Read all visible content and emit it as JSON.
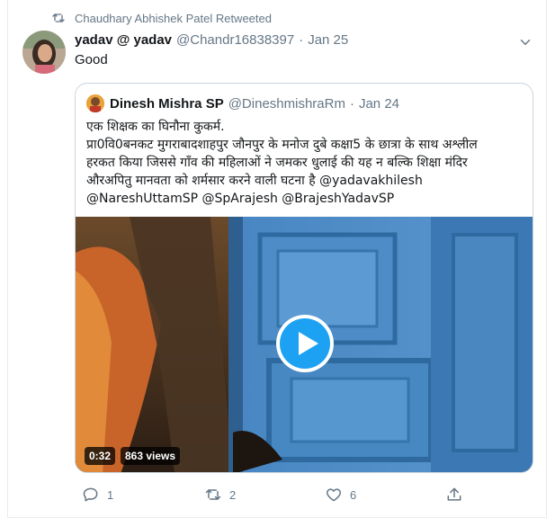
{
  "retweet": {
    "label": "Chaudhary Abhishek Patel Retweeted"
  },
  "tweet": {
    "name": "yadav @ yadav",
    "handle": "@Chandr16838397",
    "separator": "·",
    "date": "Jan 25",
    "text": "Good"
  },
  "quote": {
    "name": "Dinesh Mishra SP",
    "handle": "@DineshmishraRm",
    "separator": "·",
    "date": "Jan 24",
    "lines": [
      "एक शिक्षक का घिनौना कुकर्म.",
      "प्रा0वि0बनकट मुगराबादशाहपुर जौनपुर के मनोज दुबे कक्षा5 के छात्रा के साथ अश्लील",
      "हरकत किया जिससे गाँव की महिलाओं ने जमकर धुलाई की यह न बल्कि शिक्षा मंदिर",
      "औरअपितु मानवता को शर्मसार करने वाली घटना है @yadavakhilesh",
      "@NareshUttamSP @SpArajesh @BrajeshYadavSP"
    ],
    "video": {
      "duration": "0:32",
      "views": "863 views"
    }
  },
  "actions": {
    "replies": "1",
    "retweets": "2",
    "likes": "6"
  },
  "colors": {
    "accent": "#1da1f2",
    "muted": "#657786",
    "border": "#ccd6dd"
  },
  "icons": [
    "retweet-icon",
    "chevron-down-icon",
    "play-icon",
    "reply-icon",
    "like-icon",
    "share-icon"
  ]
}
